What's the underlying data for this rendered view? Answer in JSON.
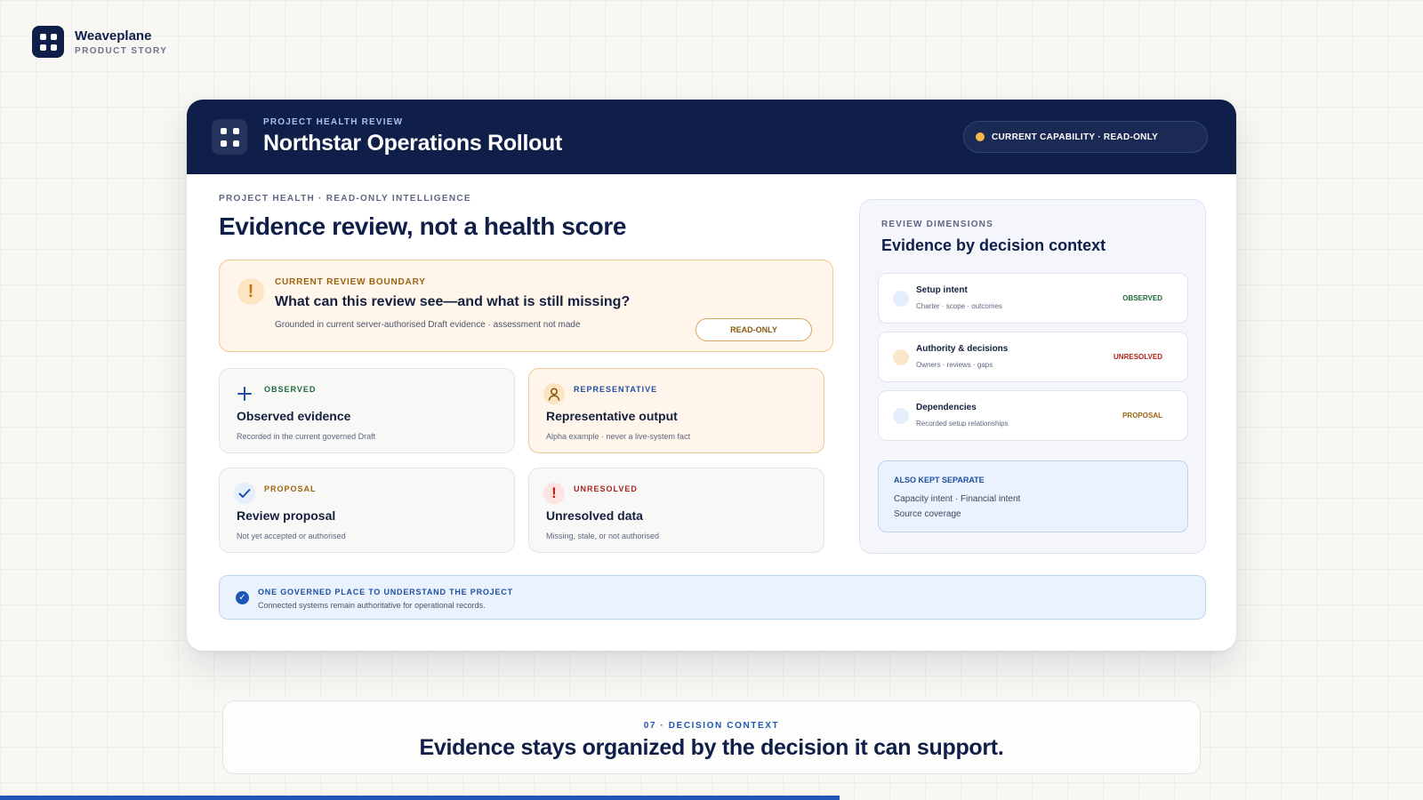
{
  "brand": {
    "name": "Weaveplane",
    "subtitle": "PRODUCT STORY"
  },
  "header": {
    "eyebrow": "PROJECT HEALTH REVIEW",
    "title": "Northstar Operations Rollout",
    "capability_pill": "CURRENT CAPABILITY · READ-ONLY"
  },
  "main": {
    "eyebrow": "PROJECT HEALTH · READ-ONLY INTELLIGENCE",
    "title": "Evidence review, not a health score",
    "boundary": {
      "icon": "warning-icon",
      "eyebrow": "CURRENT REVIEW BOUNDARY",
      "title": "What can this review see—and what is still missing?",
      "subtitle": "Grounded in current server-authorised Draft evidence · assessment not made",
      "button": "READ-ONLY"
    },
    "tiles": [
      {
        "icon": "plus-icon",
        "eyebrow": "OBSERVED",
        "title": "Observed evidence",
        "subtitle": "Recorded in the current governed Draft",
        "color": "#1f6b3c"
      },
      {
        "icon": "person-icon",
        "eyebrow": "REPRESENTATIVE",
        "title": "Representative output",
        "subtitle": "Alpha example · never a live-system fact",
        "color": "#1f4ea3"
      },
      {
        "icon": "check-icon",
        "eyebrow": "PROPOSAL",
        "title": "Review proposal",
        "subtitle": "Not yet accepted or authorised",
        "color": "#9a6512"
      },
      {
        "icon": "exclamation-icon",
        "eyebrow": "UNRESOLVED",
        "title": "Unresolved data",
        "subtitle": "Missing, stale, or not authorised",
        "color": "#a8261f"
      }
    ],
    "governed": {
      "icon": "check-circle-icon",
      "title": "ONE GOVERNED PLACE TO UNDERSTAND THE PROJECT",
      "subtitle": "Connected systems remain authoritative for operational records."
    }
  },
  "review_panel": {
    "eyebrow": "REVIEW DIMENSIONS",
    "title": "Evidence by decision context",
    "dimensions": [
      {
        "name": "Setup intent",
        "subtitle": "Charter · scope · outcomes",
        "status": "OBSERVED",
        "status_color": "#1f6b3c",
        "dot_color": "#e6eefb"
      },
      {
        "name": "Authority & decisions",
        "subtitle": "Owners · reviews · gaps",
        "status": "UNRESOLVED",
        "status_color": "#b42318",
        "dot_color": "#fbe6cc"
      },
      {
        "name": "Dependencies",
        "subtitle": "Recorded setup relationships",
        "status": "PROPOSAL",
        "status_color": "#9a6512",
        "dot_color": "#e6eefb"
      }
    ],
    "kept_separate": {
      "title": "ALSO KEPT SEPARATE",
      "line1": "Capacity intent · Financial intent",
      "line2": "Source coverage"
    }
  },
  "footer": {
    "eyebrow": "07 · DECISION CONTEXT",
    "title": "Evidence stays organized by the decision it can support."
  },
  "story_progress": 0.59
}
